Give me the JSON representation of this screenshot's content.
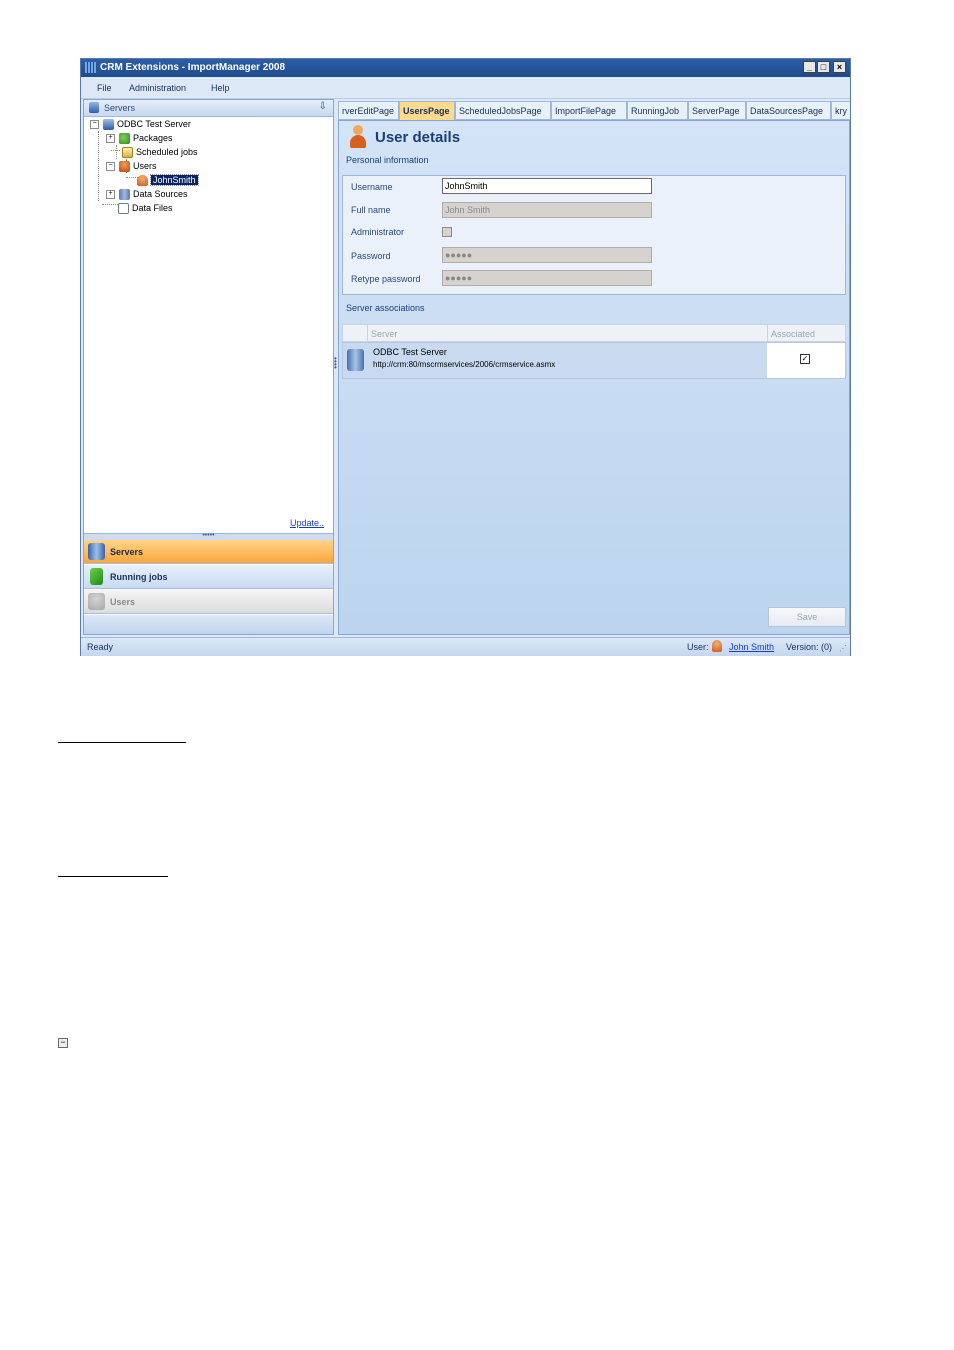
{
  "window": {
    "title": "CRM Extensions - ImportManager 2008",
    "buttons": [
      "_",
      "□",
      "×"
    ]
  },
  "menu": [
    "File",
    "Administration",
    "Help"
  ],
  "left_panel": {
    "header": "Servers",
    "tree": [
      {
        "label": "ODBC Test Server",
        "icon": "server-icon"
      },
      {
        "label": "Packages",
        "icon": "package-icon"
      },
      {
        "label": "Scheduled jobs",
        "icon": "scheduled-jobs-icon"
      },
      {
        "label": "Users",
        "icon": "users-icon"
      },
      {
        "label": "JohnSmith",
        "icon": "user-icon",
        "selected": true
      },
      {
        "label": "Data Sources",
        "icon": "data-sources-icon"
      },
      {
        "label": "Data Files",
        "icon": "data-files-icon"
      }
    ],
    "update_link": "Update..",
    "nav": [
      {
        "label": "Servers",
        "icon": "servers-icon",
        "active": true
      },
      {
        "label": "Running jobs",
        "icon": "flag-icon"
      },
      {
        "label": "Users",
        "icon": "users-icon",
        "disabled": true
      }
    ]
  },
  "tabs": [
    "rverEditPage",
    "UsersPage",
    "ScheduledJobsPage",
    "ImportFilePage",
    "RunningJob",
    "ServerPage",
    "DataSourcesPage",
    "kry"
  ],
  "active_tab": "UsersPage",
  "user_details": {
    "title": "User details",
    "personal_info_label": "Personal information",
    "fields": {
      "username_label": "Username",
      "username_value": "JohnSmith",
      "fullname_label": "Full name",
      "fullname_value": "John Smith",
      "admin_label": "Administrator",
      "password_label": "Password",
      "password_value": "●●●●●",
      "retype_label": "Retype password",
      "retype_value": "●●●●●"
    },
    "server_assoc_label": "Server associations",
    "grid": {
      "columns": [
        "Server",
        "Associated"
      ],
      "rows": [
        {
          "name": "ODBC Test Server",
          "url": "http://crm:80/mscrmservices/2006/crmservice.asmx",
          "associated": "✓"
        }
      ]
    },
    "save_label": "Save"
  },
  "status": {
    "ready": "Ready",
    "user_label": "User:",
    "user_name": "John Smith",
    "version": "Version: (0)"
  },
  "colors": {
    "titlebar": "#1e4a8a",
    "active_tab": "#ffd98c",
    "active_nav": "#f9a63c"
  }
}
